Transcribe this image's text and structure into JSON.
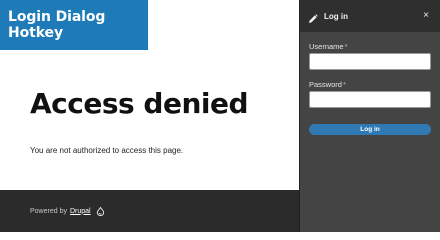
{
  "banner": {
    "text": "Login Dialog Hotkey"
  },
  "page": {
    "title": "Access denied",
    "message": "You are not authorized to access this page."
  },
  "footer": {
    "powered_by": "Powered by",
    "link_text": "Drupal"
  },
  "dialog": {
    "title": "Log in",
    "close_label": "×",
    "username_label": "Username",
    "username_value": "",
    "password_label": "Password",
    "password_value": "",
    "required_mark": "*",
    "submit_label": "Log in"
  },
  "icons": {
    "pencil": "pencil-icon",
    "close": "close-icon",
    "drupal": "drupal-drop-icon"
  },
  "colors": {
    "banner_bg": "#1f7ab8",
    "dialog_bg": "#444444",
    "dialog_header_bg": "#2f2f2f",
    "footer_bg": "#2b2b2b",
    "submit_bg": "#2f7ab5"
  }
}
